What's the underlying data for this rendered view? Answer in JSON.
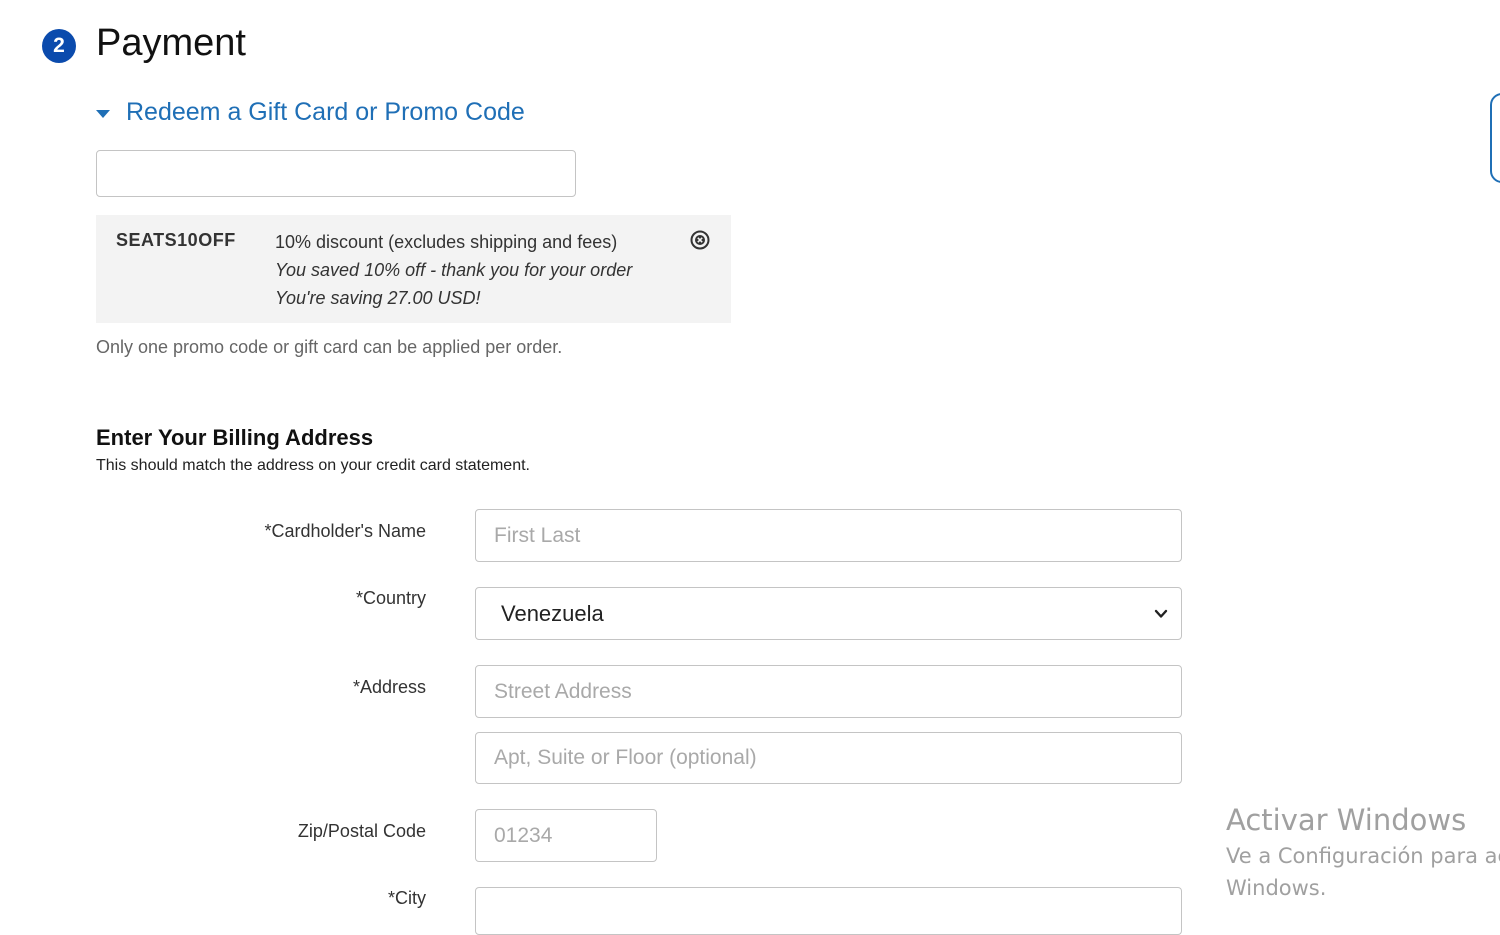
{
  "payment": {
    "step_number": "2",
    "title": "Payment"
  },
  "promo": {
    "toggle_label": "Redeem a Gift Card or Promo Code",
    "input_value": "",
    "applied": {
      "code": "SEATS10OFF",
      "description": "10% discount (excludes shipping and fees)",
      "saved_message": "You saved 10% off - thank you for your order",
      "saving_message": "You're saving 27.00 USD!"
    },
    "note": "Only one promo code or gift card can be applied per order."
  },
  "billing": {
    "title": "Enter Your Billing Address",
    "subtitle": "This should match the address on your credit card statement.",
    "fields": {
      "name": {
        "label": "*Cardholder's Name",
        "placeholder": "First Last"
      },
      "country": {
        "label": "*Country",
        "value": "Venezuela"
      },
      "address": {
        "label": "*Address",
        "placeholder": "Street Address"
      },
      "address2": {
        "placeholder": "Apt, Suite or Floor (optional)"
      },
      "zip": {
        "label": "Zip/Postal Code",
        "placeholder": "01234"
      },
      "city": {
        "label": "*City",
        "placeholder": ""
      }
    }
  },
  "watermark": {
    "title": "Activar Windows",
    "line1": "Ve a Configuración para activar",
    "line2": "Windows."
  },
  "colors": {
    "accent": "#1f6fb6",
    "badge": "#0b4bad",
    "promo_bg": "#f3f3f3"
  }
}
